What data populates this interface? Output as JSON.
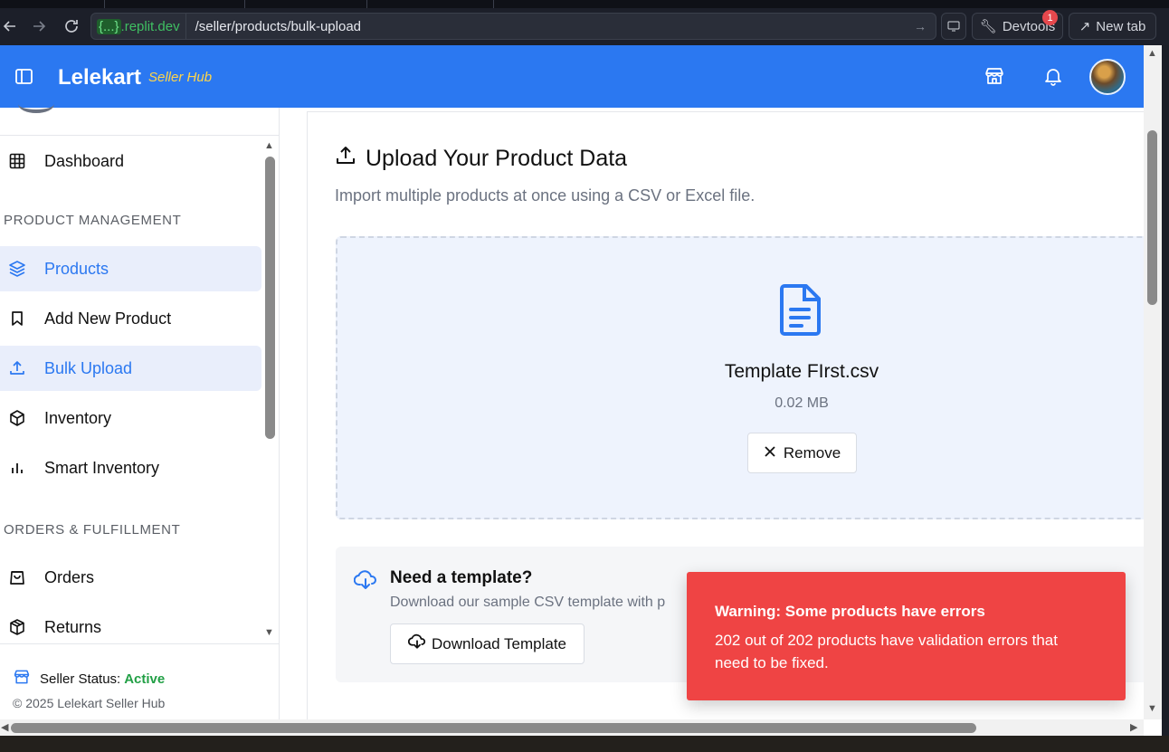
{
  "browser": {
    "host": ".replit.dev",
    "host_prefix": "{...}",
    "path": "/seller/products/bulk-upload",
    "devtools_label": "Devtools",
    "devtools_badge": "1",
    "newtab_label": "New tab"
  },
  "header": {
    "brand": "Lelekart",
    "brand_sub": "Seller Hub"
  },
  "sidebar": {
    "items": [
      {
        "label": "Dashboard",
        "icon": "grid-icon"
      },
      {
        "label": "Products",
        "icon": "layers-icon"
      },
      {
        "label": "Add New Product",
        "icon": "bookmark-icon"
      },
      {
        "label": "Bulk Upload",
        "icon": "upload-icon"
      },
      {
        "label": "Inventory",
        "icon": "box-icon"
      },
      {
        "label": "Smart Inventory",
        "icon": "bar-chart-icon"
      },
      {
        "label": "Orders",
        "icon": "shopping-bag-icon"
      },
      {
        "label": "Returns",
        "icon": "package-icon"
      }
    ],
    "sections": [
      "PRODUCT MANAGEMENT",
      "ORDERS & FULFILLMENT"
    ],
    "status_label": "Seller Status:",
    "status_value": "Active",
    "copyright": "© 2025 Lelekart Seller Hub"
  },
  "main": {
    "title": "Upload Your Product Data",
    "subtitle": "Import multiple products at once using a CSV or Excel file.",
    "file_name": "Template FIrst.csv",
    "file_size": "0.02 MB",
    "remove_label": "Remove",
    "template_title": "Need a template?",
    "template_desc": "Download our sample CSV template with p",
    "download_label": "Download Template"
  },
  "toast": {
    "title": "Warning: Some products have errors",
    "message": "202 out of 202 products have validation errors that need to be fixed."
  },
  "colors": {
    "brand_blue": "#2b78f1",
    "toast_red": "#ef4444",
    "status_green": "#22a046",
    "brand_sub_yellow": "#ffd54a"
  }
}
